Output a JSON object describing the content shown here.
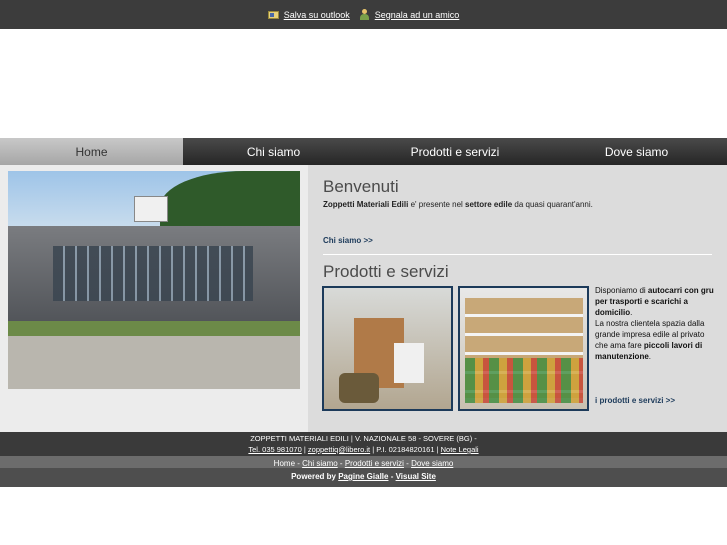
{
  "topbar": {
    "outlook_label": "Salva su outlook",
    "friend_label": "Segnala ad un amico"
  },
  "nav": {
    "items": [
      {
        "label": "Home",
        "active": true
      },
      {
        "label": "Chi siamo"
      },
      {
        "label": "Prodotti e servizi"
      },
      {
        "label": "Dove siamo"
      }
    ]
  },
  "welcome": {
    "title": "Benvenuti",
    "company": "Zoppetti Materiali Edili",
    "text_mid": " e' presente nel ",
    "sector": "settore edile",
    "text_end": " da quasi quarant'anni.",
    "link": "Chi siamo >>"
  },
  "products": {
    "title": "Prodotti e servizi",
    "p1_intro": "Disponiamo di ",
    "p1_bold": "autocarri con gru per trasporti e scarichi a domicilio",
    "p1_end": ".",
    "p2_intro": "La nostra clientela spazia dalla grande impresa edile al privato che ama fare ",
    "p2_bold": "piccoli lavori di manutenzione",
    "p2_end": ".",
    "link": "i prodotti e servizi >>"
  },
  "footer": {
    "line1": "ZOPPETTI MATERIALI EDILI | V. NAZIONALE 58 - SOVERE (BG) -",
    "tel": "Tel. 035 981070",
    "sep1": " | ",
    "email": "zoppettiq@libero.it",
    "piva": " | P.I. 02184820161 | ",
    "legal": "Note Legali",
    "nav_home": "Home",
    "nav_sep": " - ",
    "nav_chi": "Chi siamo",
    "nav_prod": "Prodotti e servizi",
    "nav_dove": "Dove siamo",
    "powered_by": "Powered by ",
    "pagine_gialle": "Pagine Gialle",
    "dash": " - ",
    "visual_site": "Visual Site"
  },
  "colors": {
    "topbar": "#3c3c3c",
    "nav_active": "#b4b4b4",
    "link": "#1c3a5a"
  }
}
